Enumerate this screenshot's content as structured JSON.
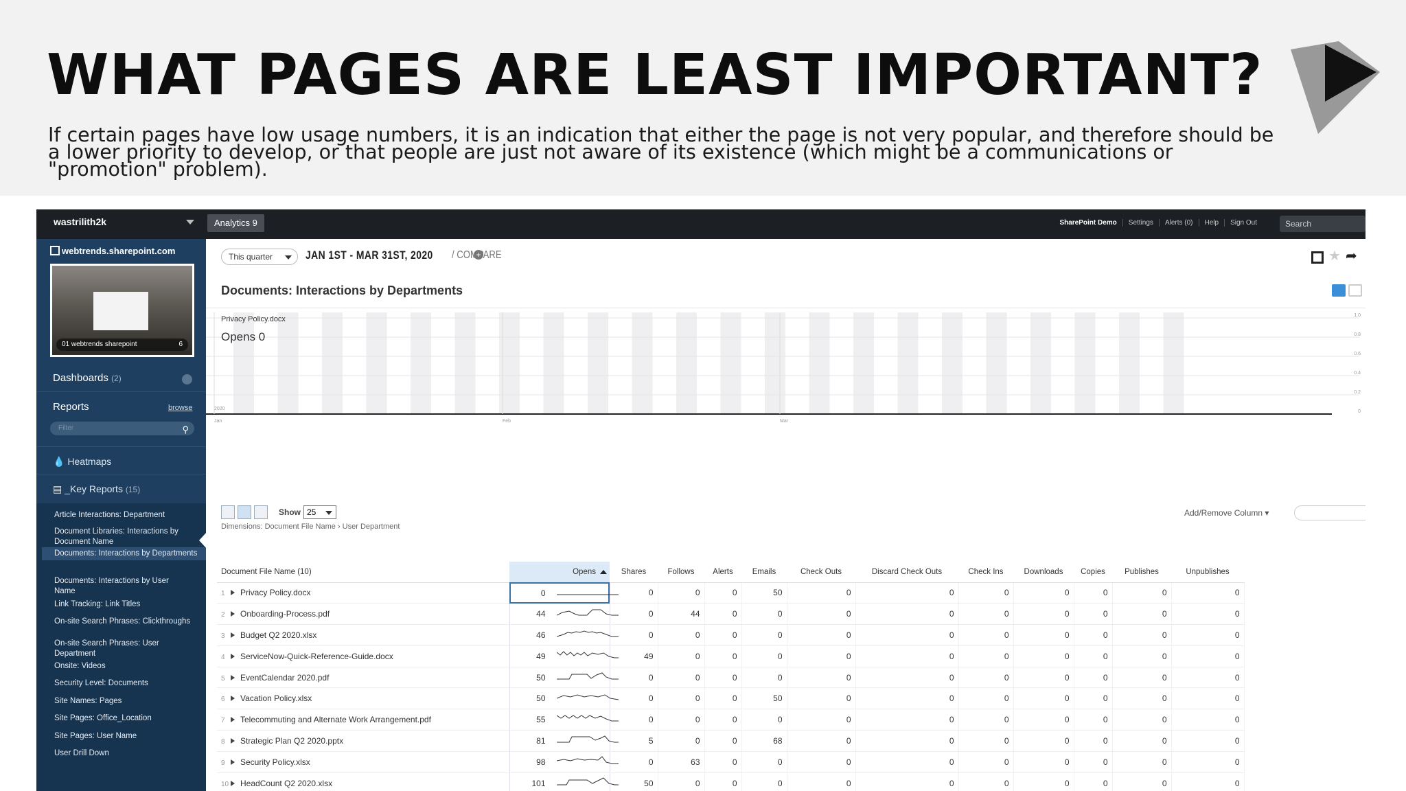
{
  "slide": {
    "title": "WHAT PAGES ARE LEAST IMPORTANT?",
    "description": "If certain pages have low usage numbers, it is an indication that either the page is not very popular, and therefore should be a lower priority to develop, or that people are just not aware of its existence (which might be a communications or \"promotion\" problem)."
  },
  "topbar": {
    "account": "wastrilith2k",
    "app_tab": "Analytics 9",
    "links": [
      "SharePoint Demo",
      "Settings",
      "Alerts (0)",
      "Help",
      "Sign Out"
    ],
    "search_placeholder": "Search"
  },
  "sidebar": {
    "site": "webtrends.sharepoint.com",
    "thumb_caption": "01 webtrends sharepoint",
    "thumb_count": "6",
    "dashboards_label": "Dashboards",
    "dashboards_count": "(2)",
    "reports_label": "Reports",
    "browse_label": "browse",
    "filter_placeholder": "Filter",
    "heatmaps_label": "Heatmaps",
    "key_reports_label": "_Key Reports",
    "key_reports_count": "(15)",
    "items": [
      "Article Interactions: Department",
      "Document Libraries: Interactions by Document Name",
      "Documents: Interactions by Departments",
      "Documents: Interactions by User Name",
      "Link Tracking: Link Titles",
      "On-site Search Phrases: Clickthroughs",
      "On-site Search Phrases: User Department",
      "Onsite: Videos",
      "Security Level: Documents",
      "Site Names: Pages",
      "Site Pages: Office_Location",
      "Site Pages: User Name",
      "User Drill Down"
    ]
  },
  "main": {
    "period": "This quarter",
    "date_from": "JAN 1ST",
    "date_to": "MAR 31ST, 2020",
    "date_range": "JAN 1ST - MAR 31ST, 2020",
    "compare": "/ COMPARE",
    "report_title": "Documents: Interactions by Departments",
    "tooltip_file": "Privacy Policy.docx",
    "tooltip_value": "Opens 0",
    "show_label": "Show",
    "show_value": "25",
    "dimensions": "Dimensions: Document File Name › User Department",
    "add_remove": "Add/Remove Column ▾",
    "table": {
      "columns": [
        "Document File Name  (10)",
        "Opens",
        "Shares",
        "Follows",
        "Alerts",
        "Emails",
        "Check Outs",
        "Discard Check Outs",
        "Check Ins",
        "Downloads",
        "Copies",
        "Publishes",
        "Unpublishes"
      ],
      "rows": [
        {
          "idx": "1",
          "name": "Privacy Policy.docx",
          "values": [
            "0",
            "0",
            "0",
            "0",
            "50",
            "0",
            "0",
            "0",
            "0",
            "0",
            "0",
            "0"
          ]
        },
        {
          "idx": "2",
          "name": "Onboarding-Process.pdf",
          "values": [
            "44",
            "0",
            "44",
            "0",
            "0",
            "0",
            "0",
            "0",
            "0",
            "0",
            "0",
            "0"
          ]
        },
        {
          "idx": "3",
          "name": "Budget Q2 2020.xlsx",
          "values": [
            "46",
            "0",
            "0",
            "0",
            "0",
            "0",
            "0",
            "0",
            "0",
            "0",
            "0",
            "0"
          ]
        },
        {
          "idx": "4",
          "name": "ServiceNow-Quick-Reference-Guide.docx",
          "values": [
            "49",
            "49",
            "0",
            "0",
            "0",
            "0",
            "0",
            "0",
            "0",
            "0",
            "0",
            "0"
          ]
        },
        {
          "idx": "5",
          "name": "EventCalendar 2020.pdf",
          "values": [
            "50",
            "0",
            "0",
            "0",
            "0",
            "0",
            "0",
            "0",
            "0",
            "0",
            "0",
            "0"
          ]
        },
        {
          "idx": "6",
          "name": "Vacation Policy.xlsx",
          "values": [
            "50",
            "0",
            "0",
            "0",
            "50",
            "0",
            "0",
            "0",
            "0",
            "0",
            "0",
            "0"
          ]
        },
        {
          "idx": "7",
          "name": "Telecommuting and Alternate Work Arrangement.pdf",
          "values": [
            "55",
            "0",
            "0",
            "0",
            "0",
            "0",
            "0",
            "0",
            "0",
            "0",
            "0",
            "0"
          ]
        },
        {
          "idx": "8",
          "name": "Strategic Plan Q2 2020.pptx",
          "values": [
            "81",
            "5",
            "0",
            "0",
            "68",
            "0",
            "0",
            "0",
            "0",
            "0",
            "0",
            "0"
          ]
        },
        {
          "idx": "9",
          "name": "Security Policy.xlsx",
          "values": [
            "98",
            "0",
            "63",
            "0",
            "0",
            "0",
            "0",
            "0",
            "0",
            "0",
            "0",
            "0"
          ]
        },
        {
          "idx": "10",
          "name": "HeadCount Q2 2020.xlsx",
          "values": [
            "101",
            "50",
            "0",
            "0",
            "0",
            "0",
            "0",
            "0",
            "0",
            "0",
            "0",
            "0"
          ]
        }
      ]
    }
  },
  "chart_data": {
    "type": "line",
    "x_ticks": [
      "2020",
      "Jan",
      "Feb",
      "Mar"
    ],
    "y_ticks": [
      "1.0",
      "0.8",
      "0.6",
      "0.4",
      "0.2",
      "0"
    ],
    "ylim": [
      0,
      1
    ],
    "series": [
      {
        "name": "Opens",
        "values": [
          0,
          0,
          0,
          0,
          0,
          0,
          0,
          0,
          0,
          0,
          0,
          0,
          0
        ]
      }
    ],
    "grid": true
  }
}
